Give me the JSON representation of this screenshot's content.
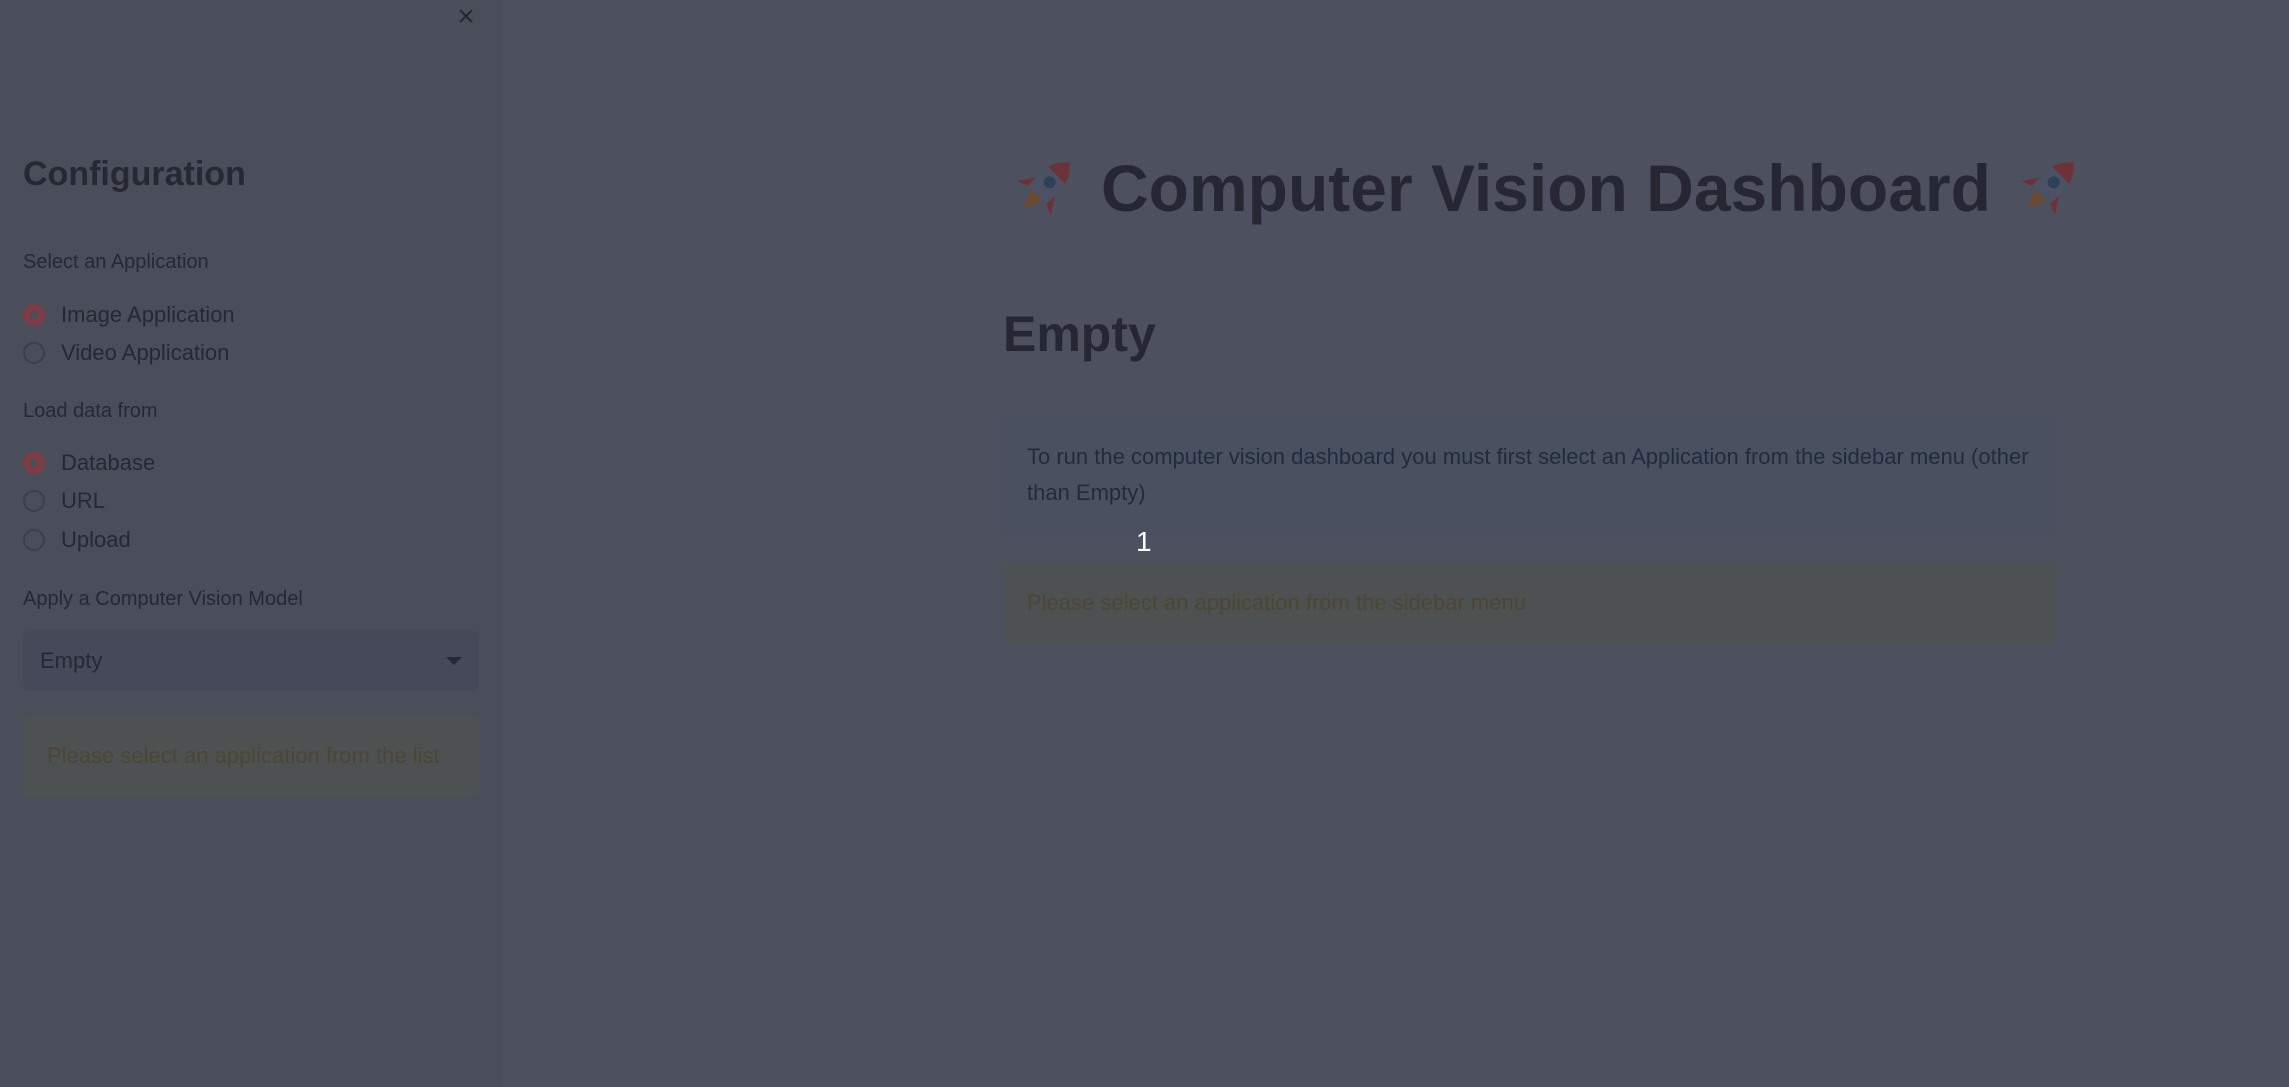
{
  "sidebar": {
    "close_icon": "close-icon",
    "title": "Configuration",
    "application_label": "Select an Application",
    "application_options": [
      {
        "label": "Image Application",
        "checked": true
      },
      {
        "label": "Video Application",
        "checked": false
      }
    ],
    "load_label": "Load data from",
    "load_options": [
      {
        "label": "Database",
        "checked": true
      },
      {
        "label": "URL",
        "checked": false
      },
      {
        "label": "Upload",
        "checked": false
      }
    ],
    "model_label": "Apply a Computer Vision Model",
    "model_select_value": "Empty",
    "warning": "Please select an application from the list"
  },
  "main": {
    "title": "Computer Vision Dashboard",
    "title_icon": "rocket-icon",
    "subtitle": "Empty",
    "info": "To run the computer vision dashboard you must first select an Application from the sidebar menu (other than Empty)",
    "warning": "Please select an application from the sidebar menu"
  },
  "overlay_label": "1",
  "colors": {
    "radio_selected": "#7e3c44",
    "overlay_text": "#ffffff"
  }
}
